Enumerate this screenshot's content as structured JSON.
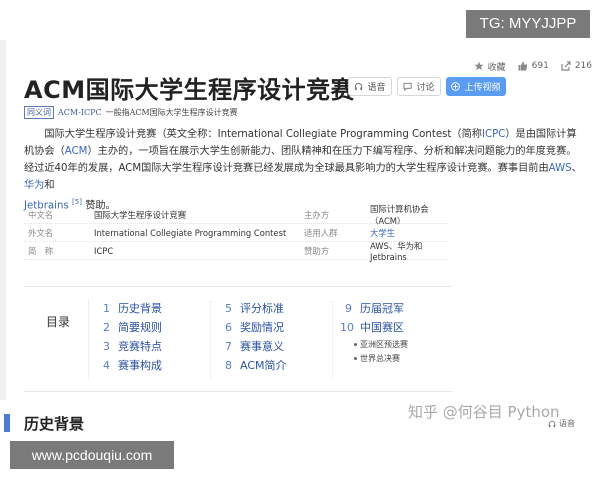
{
  "overlay": {
    "tg_label": "TG: MYYJJPP",
    "site_watermark": "www.pcdouqiu.com",
    "zhihu_watermark": "知乎 @何谷目 Python"
  },
  "stats": {
    "collect_label": "收藏",
    "likes": "691",
    "shares": "216"
  },
  "header": {
    "title": "ACM国际大学生程序设计竞赛",
    "audio_label": "语音",
    "discuss_label": "讨论",
    "upload_label": "上传视频"
  },
  "synonym": {
    "tag": "同义词",
    "link": "ACM-ICPC",
    "text": "一般指ACM国际大学生程序设计竞赛"
  },
  "intro": {
    "p1": "国际大学生程序设计竞赛（英文全称：International Collegiate Programming Contest（简称",
    "p1_link": "ICPC",
    "p2": "）是由国际计算机协会（",
    "p2_link": "ACM",
    "p3": "）主办的，一项旨在展示大学生创新能力、团队精神和在压力下编写程序、分析和解决问题能力的年度竞赛。经过近40年的发展，ACM国际大学生程序设计竞赛已经发展成为全球最具影响力的大学生程序设计竞赛。赛事目前由",
    "p3_link1": "AWS",
    "p3_sep": "、",
    "p3_link2": "华为",
    "p3_and": "和",
    "p3_link3": "Jetbrains",
    "p3_sup": "[5]",
    "p3_end": "赞助。"
  },
  "info": {
    "rows": [
      {
        "k1": "中文名",
        "v1": "国际大学生程序设计竞赛",
        "k2": "主办方",
        "v2": "国际计算机协会（ACM）"
      },
      {
        "k1": "外文名",
        "v1": "International Collegiate Programming Contest",
        "k2": "适用人群",
        "v2": "大学生"
      },
      {
        "k1": "简　称",
        "v1": "ICPC",
        "k2": "赞助方",
        "v2": "AWS、华为和Jetbrains"
      }
    ]
  },
  "toc": {
    "label": "目录",
    "items": [
      {
        "num": "1",
        "label": "历史背景"
      },
      {
        "num": "2",
        "label": "简要规则"
      },
      {
        "num": "3",
        "label": "竞赛特点"
      },
      {
        "num": "4",
        "label": "赛事构成"
      },
      {
        "num": "5",
        "label": "评分标准"
      },
      {
        "num": "6",
        "label": "奖励情况"
      },
      {
        "num": "7",
        "label": "赛事意义"
      },
      {
        "num": "8",
        "label": "ACM简介"
      },
      {
        "num": "9",
        "label": "历届冠军"
      },
      {
        "num": "10",
        "label": "中国赛区"
      }
    ],
    "subs": [
      "亚洲区预选赛",
      "世界总决赛"
    ]
  },
  "section": {
    "title": "历史背景",
    "right_label": "语音"
  }
}
